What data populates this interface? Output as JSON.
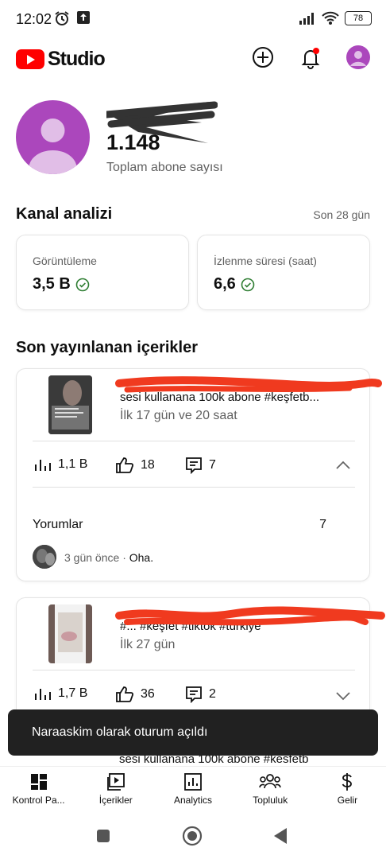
{
  "status_bar": {
    "time": "12:02",
    "battery": "78"
  },
  "app_bar": {
    "logo_text": "Studio"
  },
  "channel": {
    "subscriber_count": "1.148",
    "subscriber_label": "Toplam abone sayısı"
  },
  "analytics": {
    "title": "Kanal analizi",
    "period": "Son 28 gün",
    "metrics": [
      {
        "label": "Görüntüleme",
        "value": "3,5 B"
      },
      {
        "label": "İzlenme süresi (saat)",
        "value": "6,6"
      }
    ]
  },
  "recent": {
    "title": "Son yayınlanan içerikler",
    "videos": [
      {
        "title": "sesi kullanana 100k abone #keşfetb...",
        "subtitle": "İlk 17 gün ve 20 saat",
        "views": "1,1 B",
        "likes": "18",
        "comments": "7",
        "comments_section": {
          "label": "Yorumlar",
          "count": "7",
          "latest_time": "3 gün önce",
          "separator": "·",
          "latest_text": "Oha."
        }
      },
      {
        "title": "#... #keşfet #tiktok #türkiye",
        "subtitle": "İlk 27 gün",
        "views": "1,7 B",
        "likes": "36",
        "comments": "2"
      },
      {
        "title": "sesi kullanana 100k abone #kesfetb"
      }
    ]
  },
  "snackbar": {
    "text": "Naraaskim olarak oturum açıldı"
  },
  "bottom_nav": [
    {
      "label": "Kontrol Pa...",
      "icon": "dashboard-icon"
    },
    {
      "label": "İçerikler",
      "icon": "content-icon"
    },
    {
      "label": "Analytics",
      "icon": "analytics-icon"
    },
    {
      "label": "Topluluk",
      "icon": "community-icon"
    },
    {
      "label": "Gelir",
      "icon": "dollar-icon"
    }
  ],
  "colors": {
    "brand_red": "#ff0000",
    "avatar_purple": "#ab47bc",
    "verified_green": "#2e7d32",
    "redaction_red": "#f03a1f",
    "snackbar_bg": "#212121"
  }
}
